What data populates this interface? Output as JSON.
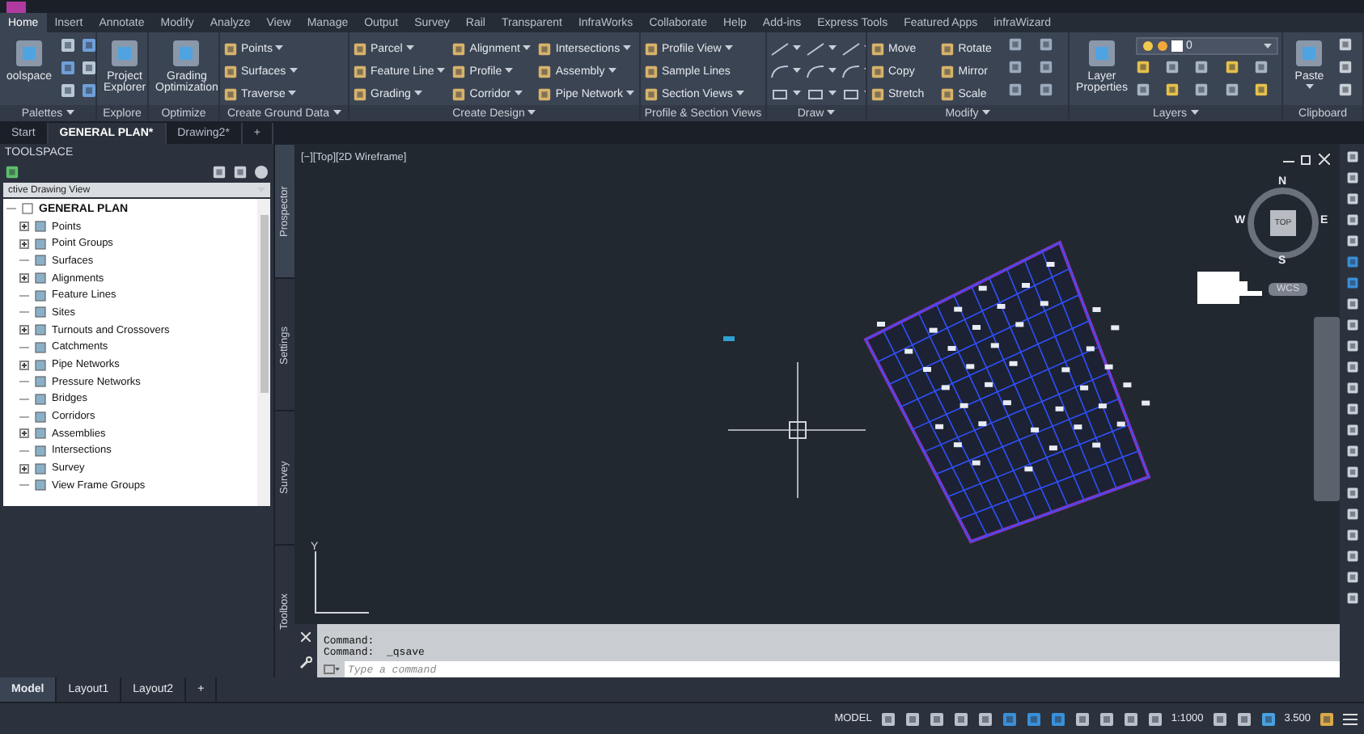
{
  "menu_tabs": [
    {
      "label": "Home",
      "selected": true
    },
    {
      "label": "Insert",
      "selected": false
    },
    {
      "label": "Annotate",
      "selected": false
    },
    {
      "label": "Modify",
      "selected": false
    },
    {
      "label": "Analyze",
      "selected": false
    },
    {
      "label": "View",
      "selected": false
    },
    {
      "label": "Manage",
      "selected": false
    },
    {
      "label": "Output",
      "selected": false
    },
    {
      "label": "Survey",
      "selected": false
    },
    {
      "label": "Rail",
      "selected": false
    },
    {
      "label": "Transparent",
      "selected": false
    },
    {
      "label": "InfraWorks",
      "selected": false
    },
    {
      "label": "Collaborate",
      "selected": false
    },
    {
      "label": "Help",
      "selected": false
    },
    {
      "label": "Add-ins",
      "selected": false
    },
    {
      "label": "Express Tools",
      "selected": false
    },
    {
      "label": "Featured Apps",
      "selected": false
    },
    {
      "label": "infraWizard",
      "selected": false
    }
  ],
  "ribbon_panels": [
    {
      "kind": "palettes",
      "title": "Palettes",
      "title_dropdown": true,
      "tools": [
        {
          "kind": "large",
          "label": "oolspace",
          "dropdown": false
        }
      ]
    },
    {
      "kind": "plain",
      "title": "Explore",
      "title_dropdown": false,
      "tools": [
        {
          "kind": "large",
          "label": "Project Explorer",
          "dropdown": false
        }
      ]
    },
    {
      "kind": "plain",
      "title": "Optimize",
      "title_dropdown": false,
      "tools": [
        {
          "kind": "large",
          "label": "Grading Optimization",
          "dropdown": false
        }
      ]
    },
    {
      "kind": "plain",
      "title": "Create Ground Data",
      "title_dropdown": true,
      "tools": [
        {
          "kind": "small",
          "label": "Points",
          "dropdown": true
        },
        {
          "kind": "small",
          "label": "Surfaces",
          "dropdown": true
        },
        {
          "kind": "small",
          "label": "Traverse",
          "dropdown": true
        }
      ]
    },
    {
      "kind": "plain",
      "title": "Create Design",
      "title_dropdown": true,
      "tools": [
        {
          "kind": "small",
          "label": "Parcel",
          "dropdown": true
        },
        {
          "kind": "small",
          "label": "Feature Line",
          "dropdown": true
        },
        {
          "kind": "small",
          "label": "Grading",
          "dropdown": true
        },
        {
          "kind": "small",
          "label": "Alignment",
          "dropdown": true
        },
        {
          "kind": "small",
          "label": "Profile",
          "dropdown": true
        },
        {
          "kind": "small",
          "label": "Corridor",
          "dropdown": true
        },
        {
          "kind": "small",
          "label": "Intersections",
          "dropdown": true
        },
        {
          "kind": "small",
          "label": "Assembly",
          "dropdown": true
        },
        {
          "kind": "small",
          "label": "Pipe Network",
          "dropdown": true
        }
      ]
    },
    {
      "kind": "plain",
      "title": "Profile & Section Views",
      "title_dropdown": false,
      "tools": [
        {
          "kind": "small",
          "label": "Profile View",
          "dropdown": true
        },
        {
          "kind": "small",
          "label": "Sample Lines",
          "dropdown": false
        },
        {
          "kind": "small",
          "label": "Section Views",
          "dropdown": true
        }
      ]
    },
    {
      "kind": "draw",
      "title": "Draw",
      "title_dropdown": true
    },
    {
      "kind": "modify",
      "title": "Modify",
      "title_dropdown": true,
      "tools": [
        {
          "kind": "small",
          "label": "Move",
          "dropdown": false
        },
        {
          "kind": "small",
          "label": "Copy",
          "dropdown": false
        },
        {
          "kind": "small",
          "label": "Stretch",
          "dropdown": false
        },
        {
          "kind": "small",
          "label": "Rotate",
          "dropdown": false
        },
        {
          "kind": "small",
          "label": "Mirror",
          "dropdown": false
        },
        {
          "kind": "small",
          "label": "Scale",
          "dropdown": false
        }
      ]
    },
    {
      "kind": "layers",
      "title": "Layers",
      "title_dropdown": true,
      "tools": [
        {
          "kind": "large",
          "label": "Layer Properties",
          "dropdown": false
        },
        {
          "kind": "combo",
          "label": "0",
          "dropdown": true
        }
      ]
    },
    {
      "kind": "clipboard",
      "title": "Clipboard",
      "title_dropdown": false,
      "tools": [
        {
          "kind": "large",
          "label": "Paste",
          "dropdown": true
        }
      ]
    }
  ],
  "doc_tabs": [
    {
      "label": "Start",
      "selected": false
    },
    {
      "label": "GENERAL PLAN*",
      "selected": true
    },
    {
      "label": "Drawing2*",
      "selected": false
    }
  ],
  "doc_tab_add": "+",
  "toolspace": {
    "title": "TOOLSPACE",
    "view_select": "ctive Drawing View",
    "tree": [
      {
        "label": "GENERAL PLAN",
        "expandable": false,
        "children": [
          {
            "label": "Points",
            "expandable": true
          },
          {
            "label": "Point Groups",
            "expandable": true
          },
          {
            "label": "Surfaces",
            "expandable": false
          },
          {
            "label": "Alignments",
            "expandable": true
          },
          {
            "label": "Feature Lines",
            "expandable": false
          },
          {
            "label": "Sites",
            "expandable": false
          },
          {
            "label": "Turnouts and Crossovers",
            "expandable": true
          },
          {
            "label": "Catchments",
            "expandable": false
          },
          {
            "label": "Pipe Networks",
            "expandable": true
          },
          {
            "label": "Pressure Networks",
            "expandable": false
          },
          {
            "label": "Bridges",
            "expandable": false
          },
          {
            "label": "Corridors",
            "expandable": false
          },
          {
            "label": "Assemblies",
            "expandable": true
          },
          {
            "label": "Intersections",
            "expandable": false
          },
          {
            "label": "Survey",
            "expandable": true
          },
          {
            "label": "View Frame Groups",
            "expandable": false
          }
        ]
      }
    ],
    "side_tabs": [
      {
        "label": "Prospector",
        "selected": true
      },
      {
        "label": "Settings",
        "selected": false
      },
      {
        "label": "Survey",
        "selected": false
      },
      {
        "label": "Toolbox",
        "selected": false
      }
    ]
  },
  "viewport": {
    "label": "[−][Top][2D Wireframe]",
    "compass": {
      "north": "N",
      "south": "S",
      "east": "E",
      "west": "W",
      "cube": "TOP"
    },
    "ucs_name": "WCS",
    "ucs_axis": "Y"
  },
  "command": {
    "history": [
      "Command:",
      "Command:  _qsave"
    ],
    "placeholder": "Type a command"
  },
  "layout_tabs": [
    {
      "label": "Model",
      "selected": true
    },
    {
      "label": "Layout1",
      "selected": false
    },
    {
      "label": "Layout2",
      "selected": false
    }
  ],
  "layout_tab_add": "+",
  "status": {
    "space": "MODEL",
    "scale": "1:1000",
    "lineweight": "3.500"
  }
}
